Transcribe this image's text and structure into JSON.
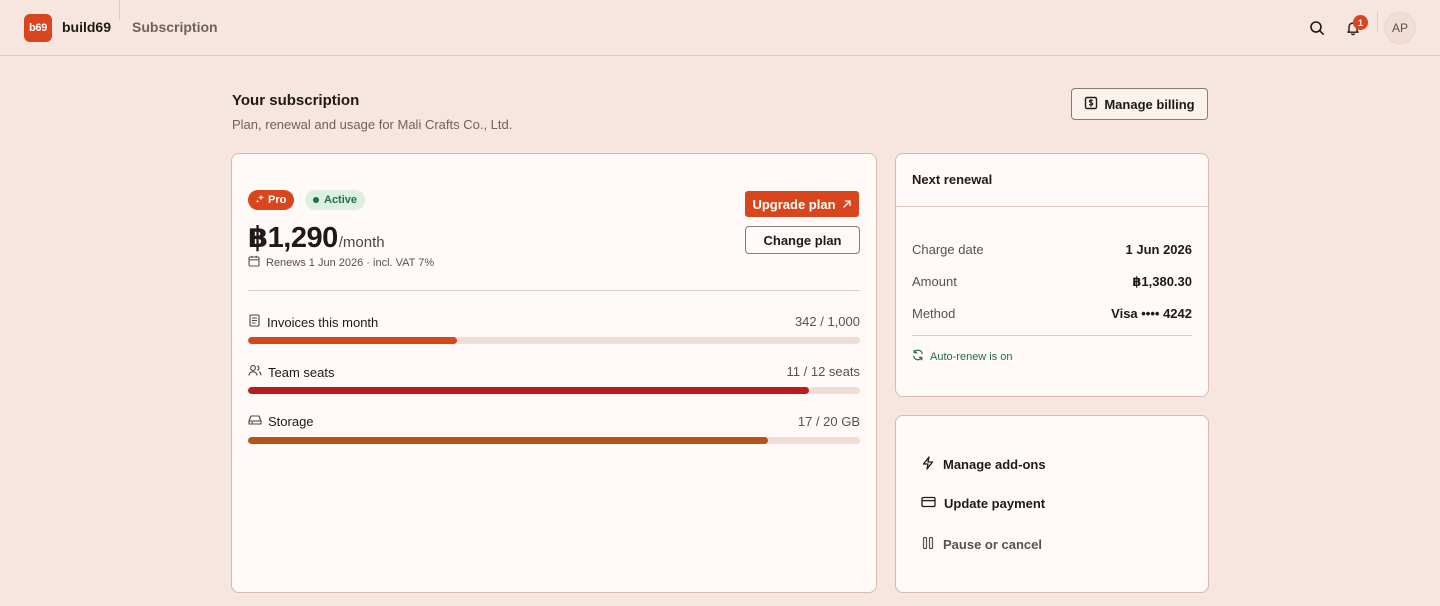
{
  "app": {
    "logo_text": "b69",
    "name": "build69",
    "section": "Subscription"
  },
  "topbar": {
    "notification_count": "1",
    "avatar_initials": "AP"
  },
  "header": {
    "title": "Your subscription",
    "subtitle": "Plan, renewal and usage for Mali Crafts Co., Ltd.",
    "manage_billing_label": "Manage billing"
  },
  "plan": {
    "tier": "Pro",
    "status": "Active",
    "price": "฿1,290",
    "period": "/month",
    "renews_text": "Renews 1 Jun 2026 · incl. VAT 7%",
    "upgrade_label": "Upgrade plan",
    "change_label": "Change plan"
  },
  "usage": [
    {
      "label": "Invoices this month",
      "value": "342 / 1,000",
      "fraction": 0.342,
      "color": "#d9461d",
      "icon": "document-icon"
    },
    {
      "label": "Team seats",
      "value": "11 / 12 seats",
      "fraction": 0.9167,
      "color": "#b91c1c",
      "icon": "users-icon"
    },
    {
      "label": "Storage",
      "value": "17 / 20 GB",
      "fraction": 0.85,
      "color": "#b4531a",
      "icon": "drive-icon"
    }
  ],
  "renewal": {
    "title": "Next renewal",
    "rows": [
      {
        "key": "Charge date",
        "value": "1 Jun 2026"
      },
      {
        "key": "Amount",
        "value": "฿1,380.30"
      },
      {
        "key": "Method",
        "value": "Visa •••• 4242"
      }
    ],
    "auto_renew": "Auto-renew is on"
  },
  "actions": [
    {
      "label": "Manage add-ons",
      "icon": "bolt-icon"
    },
    {
      "label": "Update payment",
      "icon": "credit-card-icon"
    },
    {
      "label": "Pause or cancel",
      "icon": "pause-icon"
    }
  ],
  "colors": {
    "accent": "#d9461d",
    "success": "#1f7046",
    "background": "#f7e5df"
  }
}
